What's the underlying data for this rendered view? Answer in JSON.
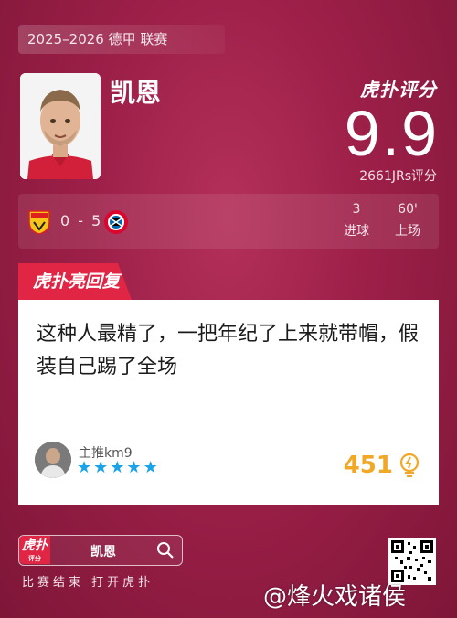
{
  "season": "2025–2026 德甲 联赛",
  "player": {
    "name": "凯恩",
    "score": "9.9",
    "rating_count": "2661JRs评分"
  },
  "brand": {
    "logo_text": "虎扑评分",
    "reply_tag": "虎扑亮回复",
    "small_logo": "虎扑",
    "small_logo_sub": "评分"
  },
  "match": {
    "score": "0 - 5",
    "home_team_icon": "stuttgart-badge-icon",
    "away_team_icon": "bayern-badge-icon",
    "stats": [
      {
        "value": "3",
        "label": "进球"
      },
      {
        "value": "60'",
        "label": "上场"
      }
    ]
  },
  "reply": {
    "text": "这种人最精了，一把年纪了上来就带帽，假装自己踢了全场",
    "username": "主推km9",
    "stars": 5,
    "likes": "451"
  },
  "footer": {
    "search_text": "凯恩",
    "tagline": "比赛结束 打开虎扑",
    "watermark": "@烽火戏诸侯"
  },
  "colors": {
    "background": "#9c1f48",
    "accent_red": "#e02545",
    "star_blue": "#1aa3e8",
    "likes_orange": "#f0a826"
  }
}
